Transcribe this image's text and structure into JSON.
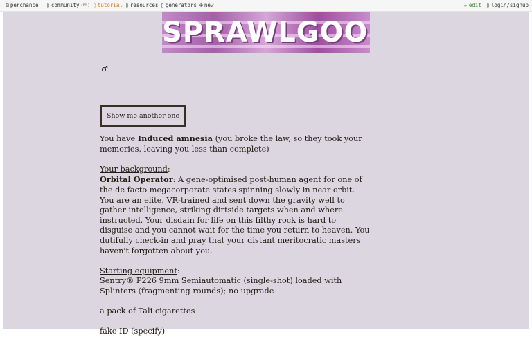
{
  "nav": {
    "perchance": "perchance",
    "community": "community",
    "community_count": "(6h)",
    "tutorial": "tutorial",
    "resources": "resources",
    "generators": "generators",
    "new": "new",
    "edit": "edit",
    "login": "login/signup"
  },
  "banner": {
    "title": "SPRAWLGOONS"
  },
  "gender_symbol": "♂",
  "button_label": "Show me another one",
  "result": {
    "intro_prefix": "You have ",
    "intro_bold": "Induced amnesia",
    "intro_suffix": " (you broke the law, so they took your memories, leaving you less than complete)",
    "background_heading": "Your background",
    "background_colon": ":",
    "background_title": "Orbital Operator",
    "background_text": ": A gene-optimised post-human agent for one of the de facto megacorporate states spinning slowly in near orbit. You are an elite, VR-trained and sent down the gravity well to gather intelligence, striking dirtside targets when and where instructed. Your disdain for life on this filthy rock is hard to disguise and you cannot wait for the time you return to heaven. You dutifully check-in and pray that your distant meritocratic masters haven't forgotten about you.",
    "equipment_heading": "Starting equipment",
    "equipment_colon": ":",
    "equipment_1": "Sentry® P226 9mm Semiautomatic (single-shot) loaded with Splinters (fragmenting rounds); no upgrade",
    "equipment_2": "a pack of Tali cigarettes",
    "equipment_3": "fake ID (specify)"
  },
  "colors": {
    "page_bg": "#dcd6e0",
    "tutorial": "#d47c1a",
    "edit": "#2e8b2e",
    "button_border": "#3a2f26"
  }
}
